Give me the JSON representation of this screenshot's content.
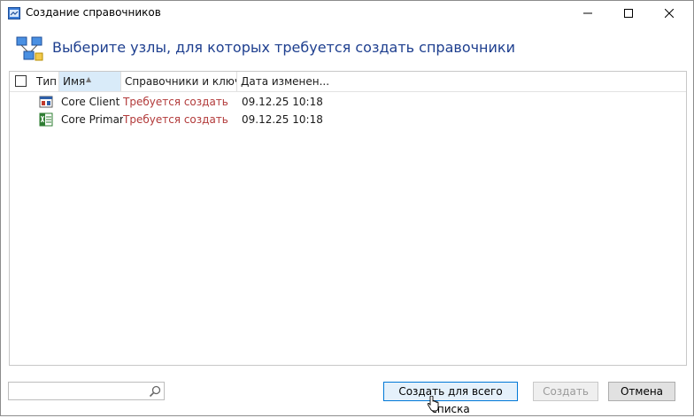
{
  "window": {
    "title": "Создание справочников",
    "icon": "app-window-icon",
    "controls": [
      "minimize-icon",
      "maximize-icon",
      "close-icon"
    ]
  },
  "header": {
    "text": "Выберите узлы, для которых требуется создать справочники",
    "icon": "network-nodes-icon"
  },
  "list": {
    "columns": {
      "type": "Тип",
      "name": "Имя",
      "ref": "Справочники и ключи",
      "date": "Дата изменен..."
    },
    "rows": [
      {
        "icon": "client-node-icon",
        "name": "Core Client",
        "ref": "Требуется создать",
        "date": "09.12.25 10:18"
      },
      {
        "icon": "primary-node-icon",
        "name": "Core Primary",
        "ref": "Требуется создать",
        "date": "09.12.25 10:18"
      }
    ]
  },
  "search": {
    "value": "",
    "icon": "search-icon"
  },
  "buttons": {
    "create_all": "Создать для всего списка",
    "create": "Создать",
    "cancel": "Отмена"
  },
  "colors": {
    "header_text": "#1e3f8f",
    "status_text": "#b23a3a",
    "primary_button_border": "#0078d7"
  }
}
